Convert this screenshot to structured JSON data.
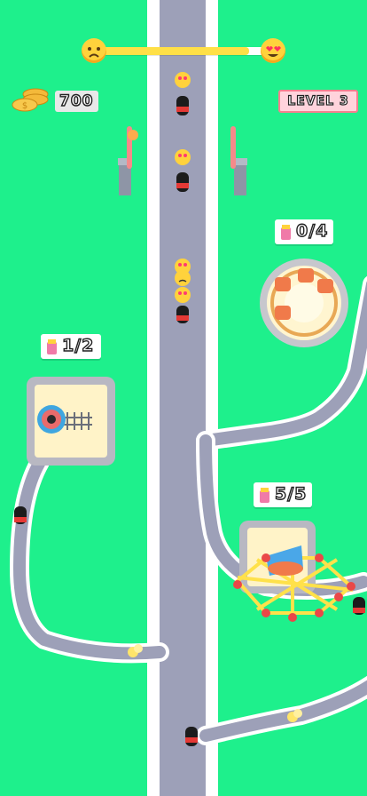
{
  "hud": {
    "progress_fraction": 0.88,
    "progress_left_icon": "sad-face-emoji-icon",
    "progress_right_icon": "heart-eyes-emoji-icon",
    "coins": "700",
    "coin_icon": "coin-stack-icon",
    "level_label": "LEVEL 3"
  },
  "stations": [
    {
      "name": "teacups-ride",
      "counter": "0/4",
      "icon": "drink-cup-icon"
    },
    {
      "name": "spinner-ride",
      "counter": "1/2",
      "icon": "drink-cup-icon"
    },
    {
      "name": "ferris-ride",
      "counter": "5/5",
      "icon": "drink-cup-icon"
    }
  ],
  "colors": {
    "grass": "#1ef08c",
    "road": "#9da0b8",
    "road_edge": "#ffffff",
    "coin": "#f4b93a",
    "level_bg": "#ffd3dc",
    "level_border": "#f87f8f"
  }
}
